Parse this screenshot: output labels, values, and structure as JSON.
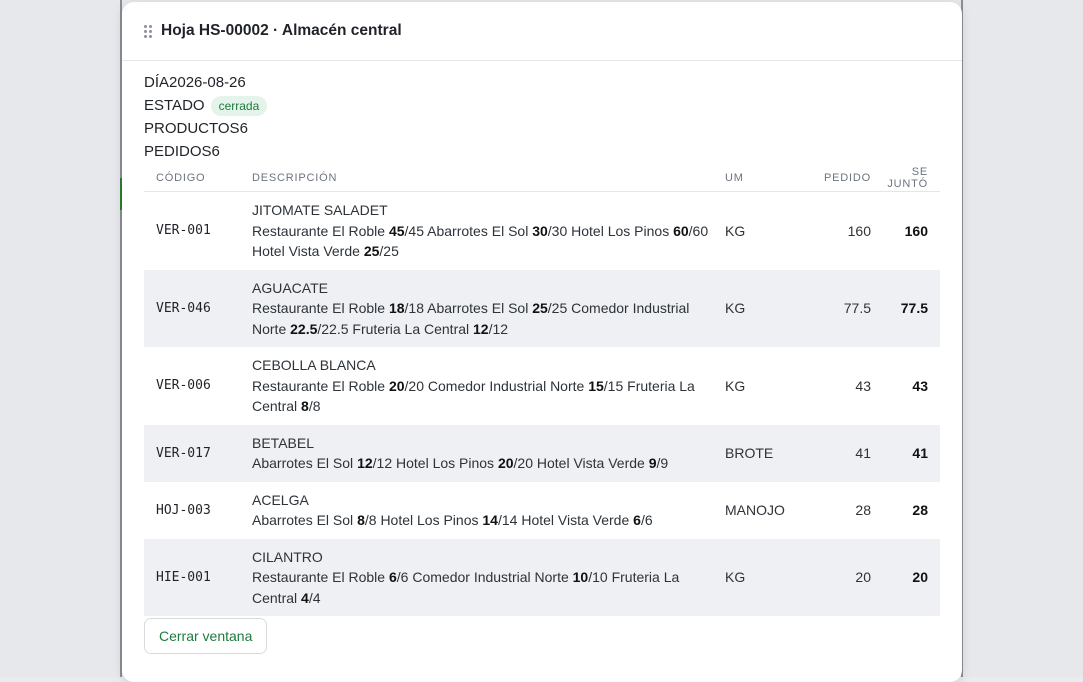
{
  "modal": {
    "title": "Hoja HS-00002 · Almacén central",
    "close_label": "Cerrar ventana"
  },
  "meta": {
    "day_label": "DÍA",
    "day_value": "2026-08-26",
    "status_label": "ESTADO",
    "status_value": "cerrada",
    "products_label": "PRODUCTOS",
    "products_value": "6",
    "orders_label": "PEDIDOS",
    "orders_value": "6"
  },
  "table": {
    "headers": [
      "CÓDIGO",
      "DESCRIPCIÓN",
      "UM",
      "PEDIDO",
      "SE JUNTÓ"
    ],
    "rows": [
      {
        "code": "VER-001",
        "name": "JITOMATE SALADET",
        "allocations": [
          {
            "client": "Restaurante El Roble",
            "got": "45",
            "total": "/45"
          },
          {
            "client": "Abarrotes El Sol",
            "got": "30",
            "total": "/30"
          },
          {
            "client": "Hotel Los Pinos",
            "got": "60",
            "total": "/60"
          },
          {
            "client": "Hotel Vista Verde",
            "got": "25",
            "total": "/25"
          }
        ],
        "um": "KG",
        "pedido": "160",
        "se_junto": "160"
      },
      {
        "code": "VER-046",
        "name": "AGUACATE",
        "allocations": [
          {
            "client": "Restaurante El Roble",
            "got": "18",
            "total": "/18"
          },
          {
            "client": "Abarrotes El Sol",
            "got": "25",
            "total": "/25"
          },
          {
            "client": "Comedor Industrial Norte",
            "got": "22.5",
            "total": "/22.5"
          },
          {
            "client": "Fruteria La Central",
            "got": "12",
            "total": "/12"
          }
        ],
        "um": "KG",
        "pedido": "77.5",
        "se_junto": "77.5"
      },
      {
        "code": "VER-006",
        "name": "CEBOLLA BLANCA",
        "allocations": [
          {
            "client": "Restaurante El Roble",
            "got": "20",
            "total": "/20"
          },
          {
            "client": "Comedor Industrial Norte",
            "got": "15",
            "total": "/15"
          },
          {
            "client": "Fruteria La Central",
            "got": "8",
            "total": "/8"
          }
        ],
        "um": "KG",
        "pedido": "43",
        "se_junto": "43"
      },
      {
        "code": "VER-017",
        "name": "BETABEL",
        "allocations": [
          {
            "client": "Abarrotes El Sol",
            "got": "12",
            "total": "/12"
          },
          {
            "client": "Hotel Los Pinos",
            "got": "20",
            "total": "/20"
          },
          {
            "client": "Hotel Vista Verde",
            "got": "9",
            "total": "/9"
          }
        ],
        "um": "BROTE",
        "pedido": "41",
        "se_junto": "41"
      },
      {
        "code": "HOJ-003",
        "name": "ACELGA",
        "allocations": [
          {
            "client": "Abarrotes El Sol",
            "got": "8",
            "total": "/8"
          },
          {
            "client": "Hotel Los Pinos",
            "got": "14",
            "total": "/14"
          },
          {
            "client": "Hotel Vista Verde",
            "got": "6",
            "total": "/6"
          }
        ],
        "um": "MANOJO",
        "pedido": "28",
        "se_junto": "28"
      },
      {
        "code": "HIE-001",
        "name": "CILANTRO",
        "allocations": [
          {
            "client": "Restaurante El Roble",
            "got": "6",
            "total": "/6"
          },
          {
            "client": "Comedor Industrial Norte",
            "got": "10",
            "total": "/10"
          },
          {
            "client": "Fruteria La Central",
            "got": "4",
            "total": "/4"
          }
        ],
        "um": "KG",
        "pedido": "20",
        "se_junto": "20"
      }
    ]
  }
}
